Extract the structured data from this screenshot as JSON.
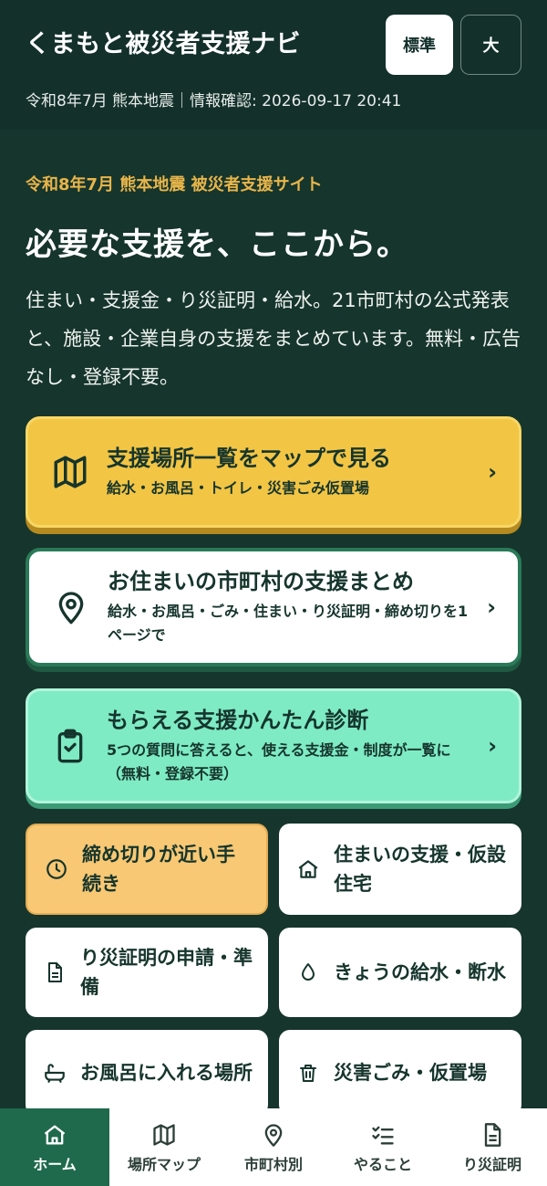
{
  "header": {
    "title": "くまもと被災者支援ナビ",
    "font_standard": "標準",
    "font_large": "大",
    "meta": "令和8年7月 熊本地震｜情報確認: 2026-09-17 20:41"
  },
  "hero": {
    "eyebrow": "令和8年7月 熊本地震 被災者支援サイト",
    "headline": "必要な支援を、ここから。",
    "lead": "住まい・支援金・り災証明・給水。21市町村の公式発表と、施設・企業自身の支援をまとめています。無料・広告なし・登録不要。"
  },
  "cards": {
    "map": {
      "title": "支援場所一覧をマップで見る",
      "sub": "給水・お風呂・トイレ・災害ごみ仮置場",
      "chevron": "›"
    },
    "area": {
      "title": "お住まいの市町村の支援まとめ",
      "sub": "給水・お風呂・ごみ・住まい・り災証明・締め切りを1ページで",
      "chevron": "›"
    },
    "diagnosis": {
      "title": "もらえる支援かんたん診断",
      "sub": "5つの質問に答えると、使える支援金・制度が一覧に（無料・登録不要）",
      "chevron": "›"
    }
  },
  "tiles": {
    "deadline": "締め切りが近い手続き",
    "housing": "住まいの支援・仮設住宅",
    "certificate": "り災証明の申請・準備",
    "water": "きょうの給水・断水",
    "bath": "お風呂に入れる場所",
    "garbage": "災害ごみ・仮置場"
  },
  "tabs": [
    {
      "label": "ホーム",
      "icon": "home-icon"
    },
    {
      "label": "場所マップ",
      "icon": "map-icon"
    },
    {
      "label": "市町村別",
      "icon": "pin-icon"
    },
    {
      "label": "やること",
      "icon": "checklist-icon"
    },
    {
      "label": "り災証明",
      "icon": "document-icon"
    }
  ],
  "colors": {
    "background": "#16352c",
    "accent_yellow": "#f2c544",
    "accent_mint": "#7eebc5",
    "accent_orange": "#f8c874",
    "eyebrow": "#e8b54a",
    "active_tab": "#1f6a4d"
  }
}
